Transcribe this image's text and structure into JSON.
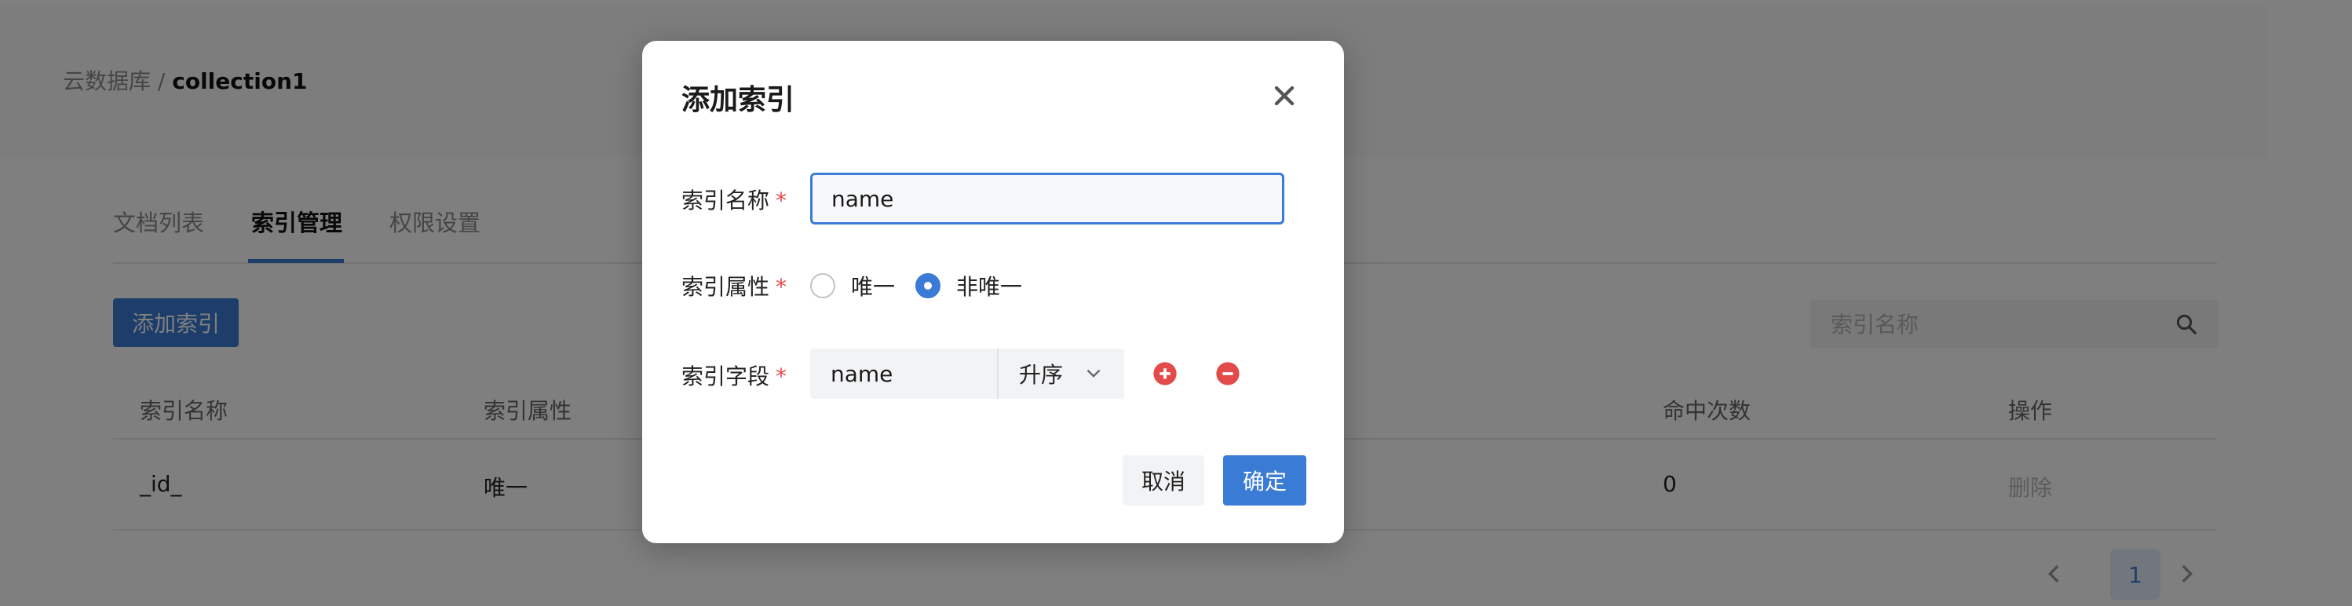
{
  "breadcrumb": {
    "root": "云数据库",
    "separator": " / ",
    "current": "collection1"
  },
  "tabs": [
    {
      "label": "文档列表"
    },
    {
      "label": "索引管理",
      "active": true
    },
    {
      "label": "权限设置"
    }
  ],
  "toolbar": {
    "add_index_label": "添加索引",
    "search_placeholder": "索引名称"
  },
  "table": {
    "columns": [
      "索引名称",
      "索引属性",
      "命中次数",
      "操作"
    ],
    "rows": [
      {
        "name": "_id_",
        "property": "唯一",
        "hits": "0",
        "action": "删除"
      }
    ]
  },
  "pagination": {
    "current_page": "1"
  },
  "dialog": {
    "title": "添加索引",
    "fields": {
      "index_name": {
        "label": "索引名称",
        "value": "name"
      },
      "index_property": {
        "label": "索引属性",
        "options": [
          "唯一",
          "非唯一"
        ],
        "selected": "非唯一"
      },
      "index_field": {
        "label": "索引字段",
        "value": "name",
        "order": "升序"
      }
    },
    "required_mark": "*",
    "cancel_label": "取消",
    "ok_label": "确定"
  },
  "colors": {
    "accent": "#3a7bd5",
    "required": "#e34b4b",
    "add": "#e34b4b",
    "remove": "#e34b4b"
  },
  "icons": {
    "close": "close-icon",
    "search": "search-icon",
    "chevron": "chevron-down-icon",
    "add": "plus-circle-icon",
    "remove": "minus-circle-icon"
  }
}
